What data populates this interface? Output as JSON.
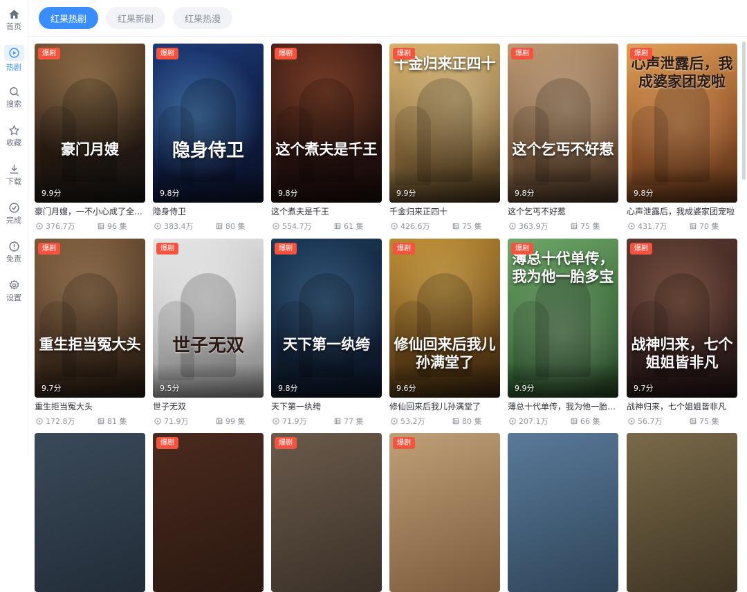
{
  "sidebar": {
    "items": [
      {
        "label": "首页",
        "icon": "home-icon"
      },
      {
        "label": "热剧",
        "icon": "play-circle-icon"
      },
      {
        "label": "搜索",
        "icon": "search-icon"
      },
      {
        "label": "收藏",
        "icon": "star-icon"
      },
      {
        "label": "下载",
        "icon": "download-icon"
      },
      {
        "label": "完成",
        "icon": "check-circle-icon"
      },
      {
        "label": "免责",
        "icon": "alert-circle-icon"
      },
      {
        "label": "设置",
        "icon": "gear-icon"
      }
    ],
    "active_index": 1
  },
  "tabs": [
    {
      "label": "红果热剧"
    },
    {
      "label": "红果新剧"
    },
    {
      "label": "红果热漫"
    }
  ],
  "active_tab": 0,
  "badge_label": "爆剧",
  "colors": {
    "accent": "#3a8dff",
    "badge": "#f5533d",
    "text_primary": "#2b2f36",
    "text_secondary": "#8e949c"
  },
  "dramas": [
    {
      "title": "豪门月嫂，一不小心成了全家的白月光",
      "poster_text": "豪门月嫂",
      "score": "9.9分",
      "views": "376.7万",
      "episodes": "96 集"
    },
    {
      "title": "隐身侍卫",
      "poster_text": "隐身侍卫",
      "score": "9.8分",
      "views": "383.4万",
      "episodes": "80 集"
    },
    {
      "title": "这个煮夫是千王",
      "poster_text": "这个煮夫是千王",
      "score": "9.8分",
      "views": "554.7万",
      "episodes": "61 集"
    },
    {
      "title": "千金归来正四十",
      "poster_text": "千金归来正四十",
      "score": "9.9分",
      "views": "426.6万",
      "episodes": "75 集"
    },
    {
      "title": "这个乞丐不好惹",
      "poster_text": "这个乞丐不好惹",
      "score": "9.8分",
      "views": "363.9万",
      "episodes": "75 集"
    },
    {
      "title": "心声泄露后，我成婆家团宠啦",
      "poster_text": "心声泄露后，我成婆家团宠啦",
      "score": "9.8分",
      "views": "431.7万",
      "episodes": "70 集"
    },
    {
      "title": "重生拒当冤大头",
      "poster_text": "重生拒当冤大头",
      "score": "9.7分",
      "views": "172.8万",
      "episodes": "81 集"
    },
    {
      "title": "世子无双",
      "poster_text": "世子无双",
      "score": "9.5分",
      "views": "71.9万",
      "episodes": "99 集"
    },
    {
      "title": "天下第一纨绔",
      "poster_text": "天下第一纨绔",
      "score": "9.8分",
      "views": "71.9万",
      "episodes": "77 集"
    },
    {
      "title": "修仙回来后我儿孙满堂了",
      "poster_text": "修仙回来后我儿孙满堂了",
      "score": "9.6分",
      "views": "53.2万",
      "episodes": "80 集"
    },
    {
      "title": "薄总十代单传，我为他一胎多宝",
      "poster_text": "薄总十代单传，我为他一胎多宝",
      "score": "9.9分",
      "views": "207.1万",
      "episodes": "66 集"
    },
    {
      "title": "战神归来，七个姐姐皆非凡",
      "poster_text": "战神归来，七个姐姐皆非凡",
      "score": "9.7分",
      "views": "56.7万",
      "episodes": "75 集"
    },
    {
      "title": "",
      "poster_text": "",
      "score": "",
      "views": "",
      "episodes": ""
    },
    {
      "title": "",
      "poster_text": "",
      "score": "",
      "views": "",
      "episodes": ""
    },
    {
      "title": "",
      "poster_text": "",
      "score": "",
      "views": "",
      "episodes": ""
    },
    {
      "title": "",
      "poster_text": "",
      "score": "",
      "views": "",
      "episodes": ""
    },
    {
      "title": "",
      "poster_text": "",
      "score": "",
      "views": "",
      "episodes": ""
    },
    {
      "title": "",
      "poster_text": "",
      "score": "",
      "views": "",
      "episodes": ""
    }
  ]
}
